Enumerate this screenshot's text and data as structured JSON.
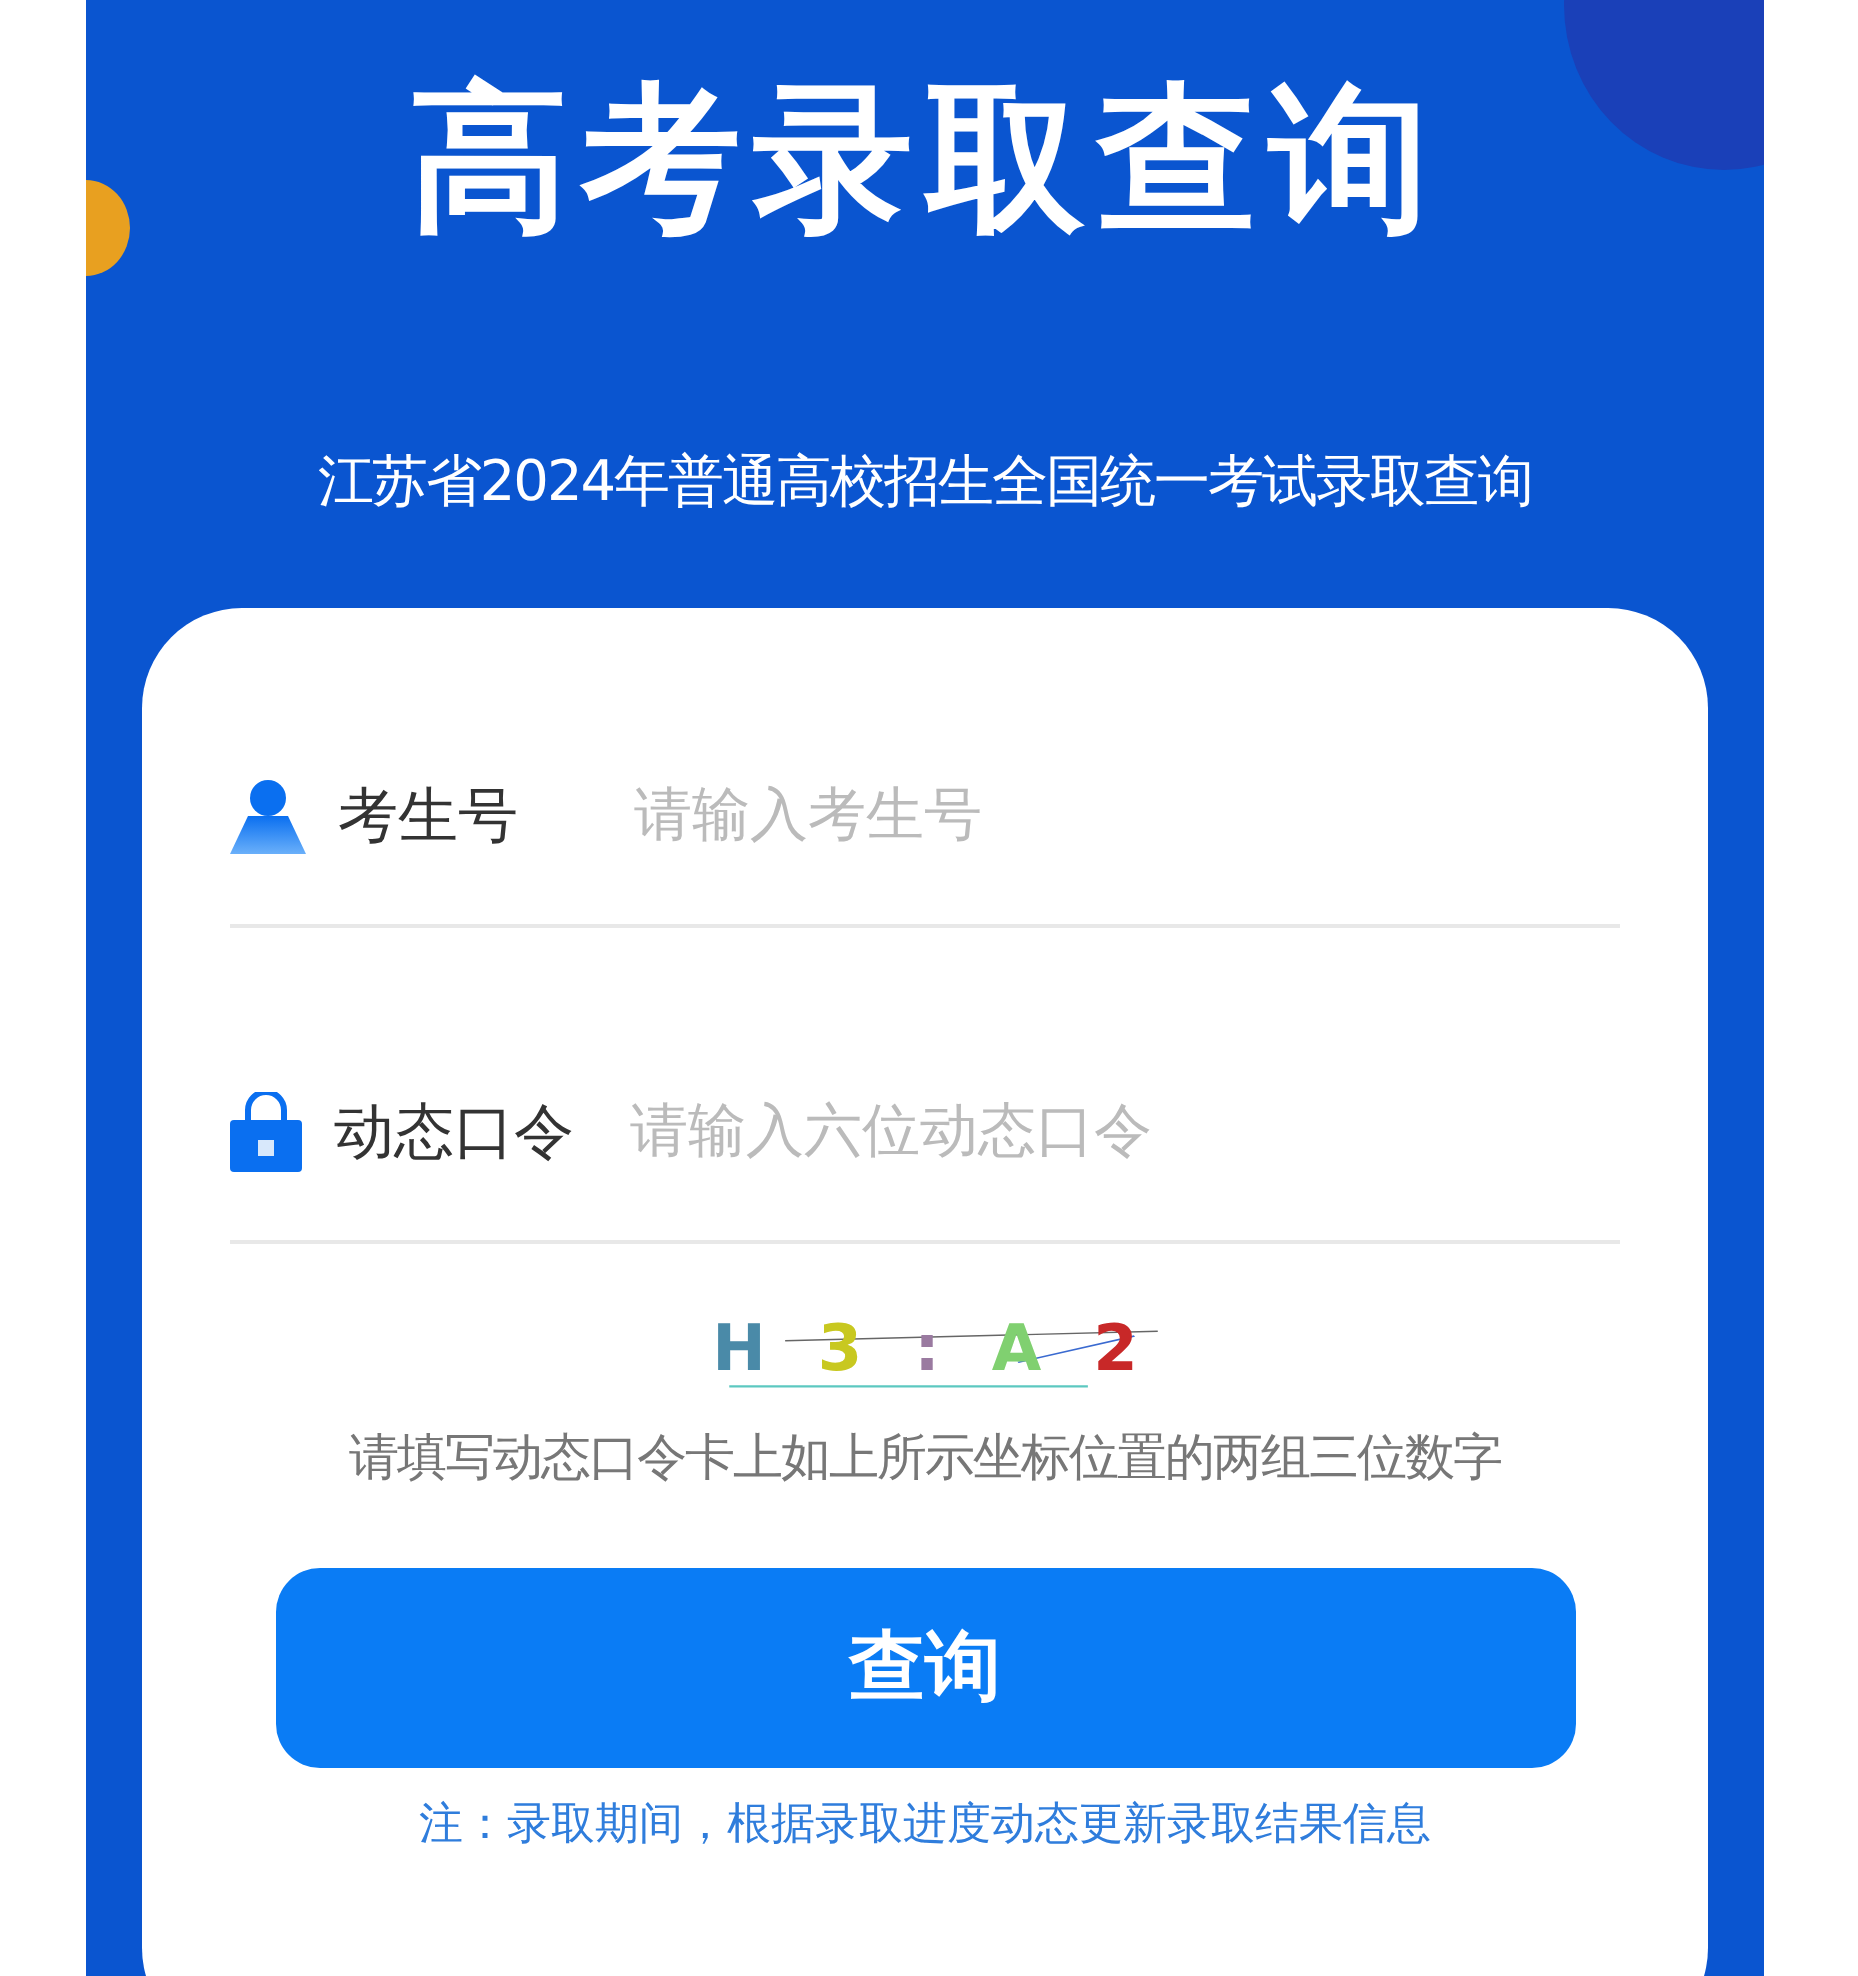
{
  "title": "高考录取查询",
  "subtitle": "江苏省2024年普通高校招生全国统一考试录取查询",
  "fields": [
    {
      "kind": "user",
      "label": "考生号",
      "placeholder": "请输入考生号"
    },
    {
      "kind": "lock",
      "label": "动态口令",
      "placeholder": "请输入六位动态口令"
    }
  ],
  "captcha": [
    {
      "text": "H",
      "color": "#4a8aa8"
    },
    {
      "text": "3",
      "color": "#c8c820"
    },
    {
      "text": ":",
      "color": "#9a7aa0"
    },
    {
      "text": "A",
      "color": "#80d070"
    },
    {
      "text": "2",
      "color": "#c82828"
    }
  ],
  "hint": "请填写动态口令卡上如上所示坐标位置的两组三位数字",
  "button": "查询",
  "note": "注：录取期间，根据录取进度动态更新录取结果信息"
}
